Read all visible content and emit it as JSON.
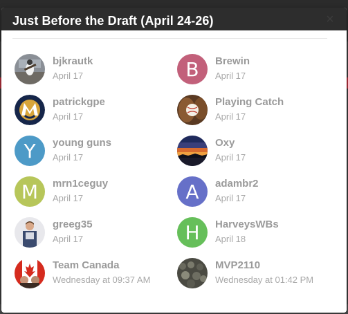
{
  "modal": {
    "title": "Just Before the Draft (April 24-26)",
    "close_glyph": "×"
  },
  "members": [
    {
      "name": "bjkrautk",
      "date": "April 17",
      "avatar_type": "photo-baseball-player",
      "avatar_letter": "",
      "avatar_color": ""
    },
    {
      "name": "Brewin",
      "date": "April 17",
      "avatar_type": "letter",
      "avatar_letter": "B",
      "avatar_color": "#c2607a"
    },
    {
      "name": "patrickgpe",
      "date": "April 17",
      "avatar_type": "photo-brewers-logo",
      "avatar_letter": "",
      "avatar_color": ""
    },
    {
      "name": "Playing Catch",
      "date": "April 17",
      "avatar_type": "photo-baseball-glove",
      "avatar_letter": "",
      "avatar_color": ""
    },
    {
      "name": "young guns",
      "date": "April 17",
      "avatar_type": "letter",
      "avatar_letter": "Y",
      "avatar_color": "#4d9ac7"
    },
    {
      "name": "Oxy",
      "date": "April 17",
      "avatar_type": "photo-sunset",
      "avatar_letter": "",
      "avatar_color": ""
    },
    {
      "name": "mrn1ceguy",
      "date": "April 17",
      "avatar_type": "letter",
      "avatar_letter": "M",
      "avatar_color": "#b7c65a"
    },
    {
      "name": "adambr2",
      "date": "April 17",
      "avatar_type": "letter",
      "avatar_letter": "A",
      "avatar_color": "#6670c8"
    },
    {
      "name": "greeg35",
      "date": "April 17",
      "avatar_type": "photo-person",
      "avatar_letter": "",
      "avatar_color": ""
    },
    {
      "name": "HarveysWBs",
      "date": "April 18",
      "avatar_type": "letter",
      "avatar_letter": "H",
      "avatar_color": "#66bf5a"
    },
    {
      "name": "Team Canada",
      "date": "Wednesday at 09:37 AM",
      "avatar_type": "photo-team-canada",
      "avatar_letter": "",
      "avatar_color": ""
    },
    {
      "name": "MVP2110",
      "date": "Wednesday at 01:42 PM",
      "avatar_type": "photo-crowd",
      "avatar_letter": "",
      "avatar_color": ""
    }
  ],
  "colors": {
    "header_bg": "#2d2d2d",
    "name_text": "#9a9a9a",
    "date_text": "#a8a8a8"
  }
}
